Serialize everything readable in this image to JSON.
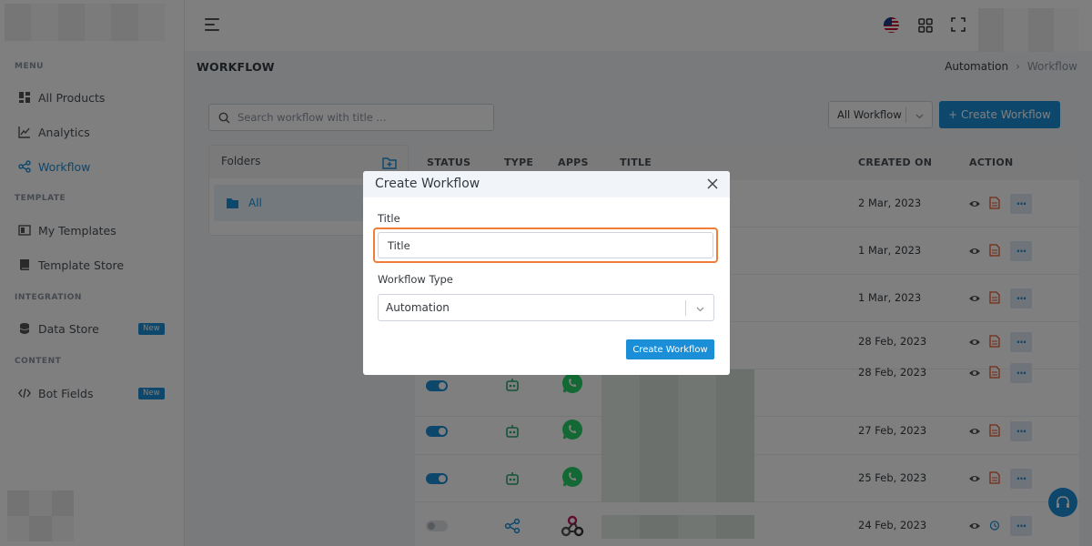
{
  "sidebar": {
    "sections": {
      "menu": "MENU",
      "template": "TEMPLATE",
      "integration": "INTEGRATION",
      "content": "CONTENT"
    },
    "items": [
      {
        "label": "All Products",
        "icon": "grid-icon"
      },
      {
        "label": "Analytics",
        "icon": "chart-line-icon"
      },
      {
        "label": "Workflow",
        "icon": "share-nodes-icon",
        "active": true
      },
      {
        "label": "My Templates",
        "icon": "template-icon"
      },
      {
        "label": "Template Store",
        "icon": "book-icon"
      },
      {
        "label": "Data Store",
        "icon": "database-icon",
        "badge": "New"
      },
      {
        "label": "Bot Fields",
        "icon": "code-icon",
        "badge": "New"
      }
    ]
  },
  "page": {
    "title": "WORKFLOW",
    "breadcrumb": [
      "Automation",
      "Workflow"
    ]
  },
  "toolbar": {
    "search_placeholder": "Search workflow with title ...",
    "filter_value": "All Workflow",
    "create_label": "+ Create Workflow"
  },
  "folders": {
    "title": "Folders",
    "items": [
      "All"
    ]
  },
  "table": {
    "columns": [
      "STATUS",
      "TYPE",
      "APPS",
      "TITLE",
      "CREATED ON",
      "ACTION"
    ],
    "rows": [
      {
        "created_on": "2 Mar, 2023"
      },
      {
        "created_on": "1 Mar, 2023"
      },
      {
        "created_on": "1 Mar, 2023"
      },
      {
        "created_on": "28 Feb, 2023"
      },
      {
        "created_on": "28 Feb, 2023",
        "status": "on",
        "type": "bot-icon",
        "app": "whatsapp-icon"
      },
      {
        "created_on": "27 Feb, 2023",
        "status": "on",
        "type": "bot-icon",
        "app": "whatsapp-icon"
      },
      {
        "created_on": "25 Feb, 2023",
        "status": "on",
        "type": "bot-icon",
        "app": "whatsapp-icon"
      },
      {
        "created_on": "24 Feb, 2023",
        "status": "off",
        "type": "share-nodes-icon",
        "app": "webhook-icon"
      }
    ],
    "more_label": "···"
  },
  "modal": {
    "title": "Create Workflow",
    "title_label": "Title",
    "title_value": "Title",
    "type_label": "Workflow Type",
    "type_value": "Automation",
    "submit_label": "Create Workflow"
  },
  "colors": {
    "accent": "#1a8fd8",
    "focus_ring": "#f07e38",
    "overlay": "rgba(0,0,0,0.5)"
  }
}
